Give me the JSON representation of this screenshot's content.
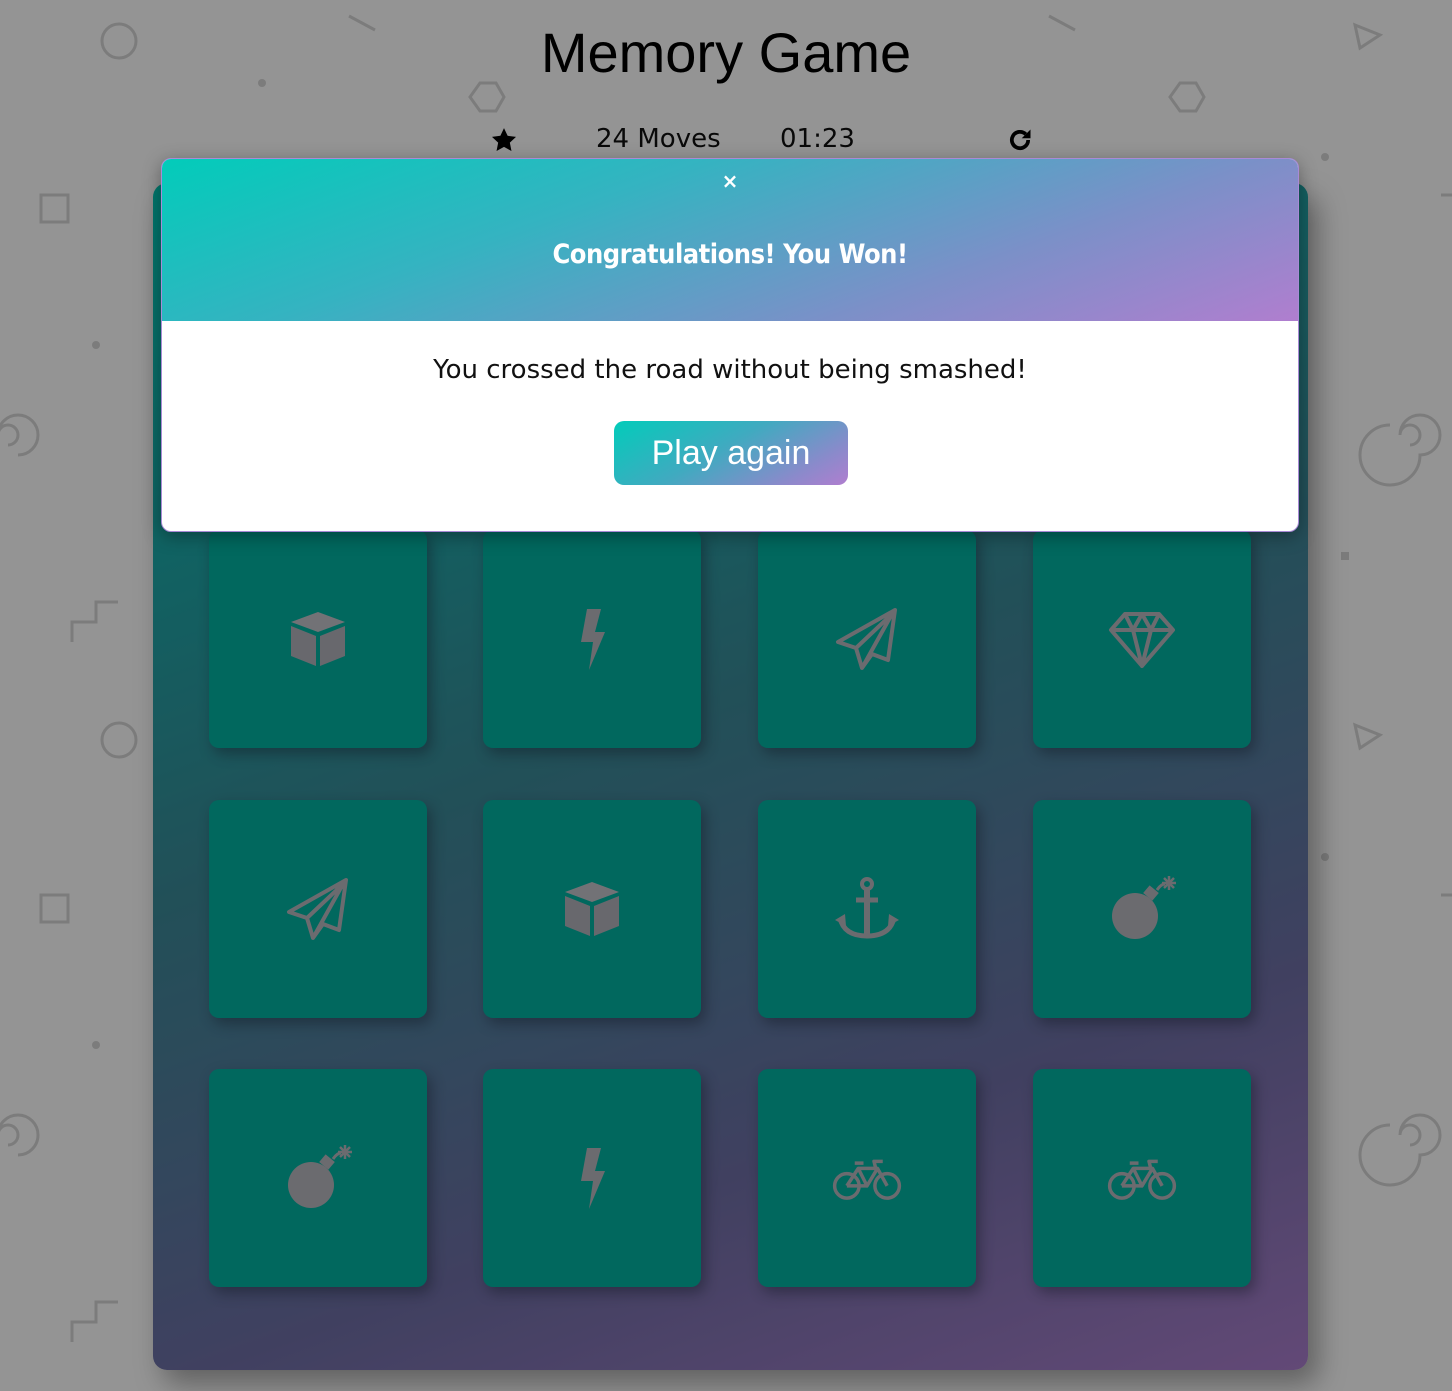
{
  "header": {
    "title": "Memory Game"
  },
  "score_panel": {
    "stars_shown": 1,
    "moves_label": "24 Moves",
    "timer": "01:23"
  },
  "deck": {
    "card_icons": [
      "cube-icon",
      "bolt-icon",
      "paper-plane-icon",
      "diamond-icon",
      "paper-plane-icon",
      "cube-icon",
      "anchor-icon",
      "bomb-icon",
      "bomb-icon",
      "bolt-icon",
      "bicycle-icon",
      "bicycle-icon"
    ]
  },
  "modal": {
    "close_label": "×",
    "title": "Congratulations! You Won!",
    "message": "You crossed the road without being smashed!",
    "play_again_label": "Play again"
  },
  "colors": {
    "gradient_start": "#02ccba",
    "gradient_end": "#aa7ecd",
    "card_face": "#02b3a2",
    "icon": "#b9b9c0"
  }
}
